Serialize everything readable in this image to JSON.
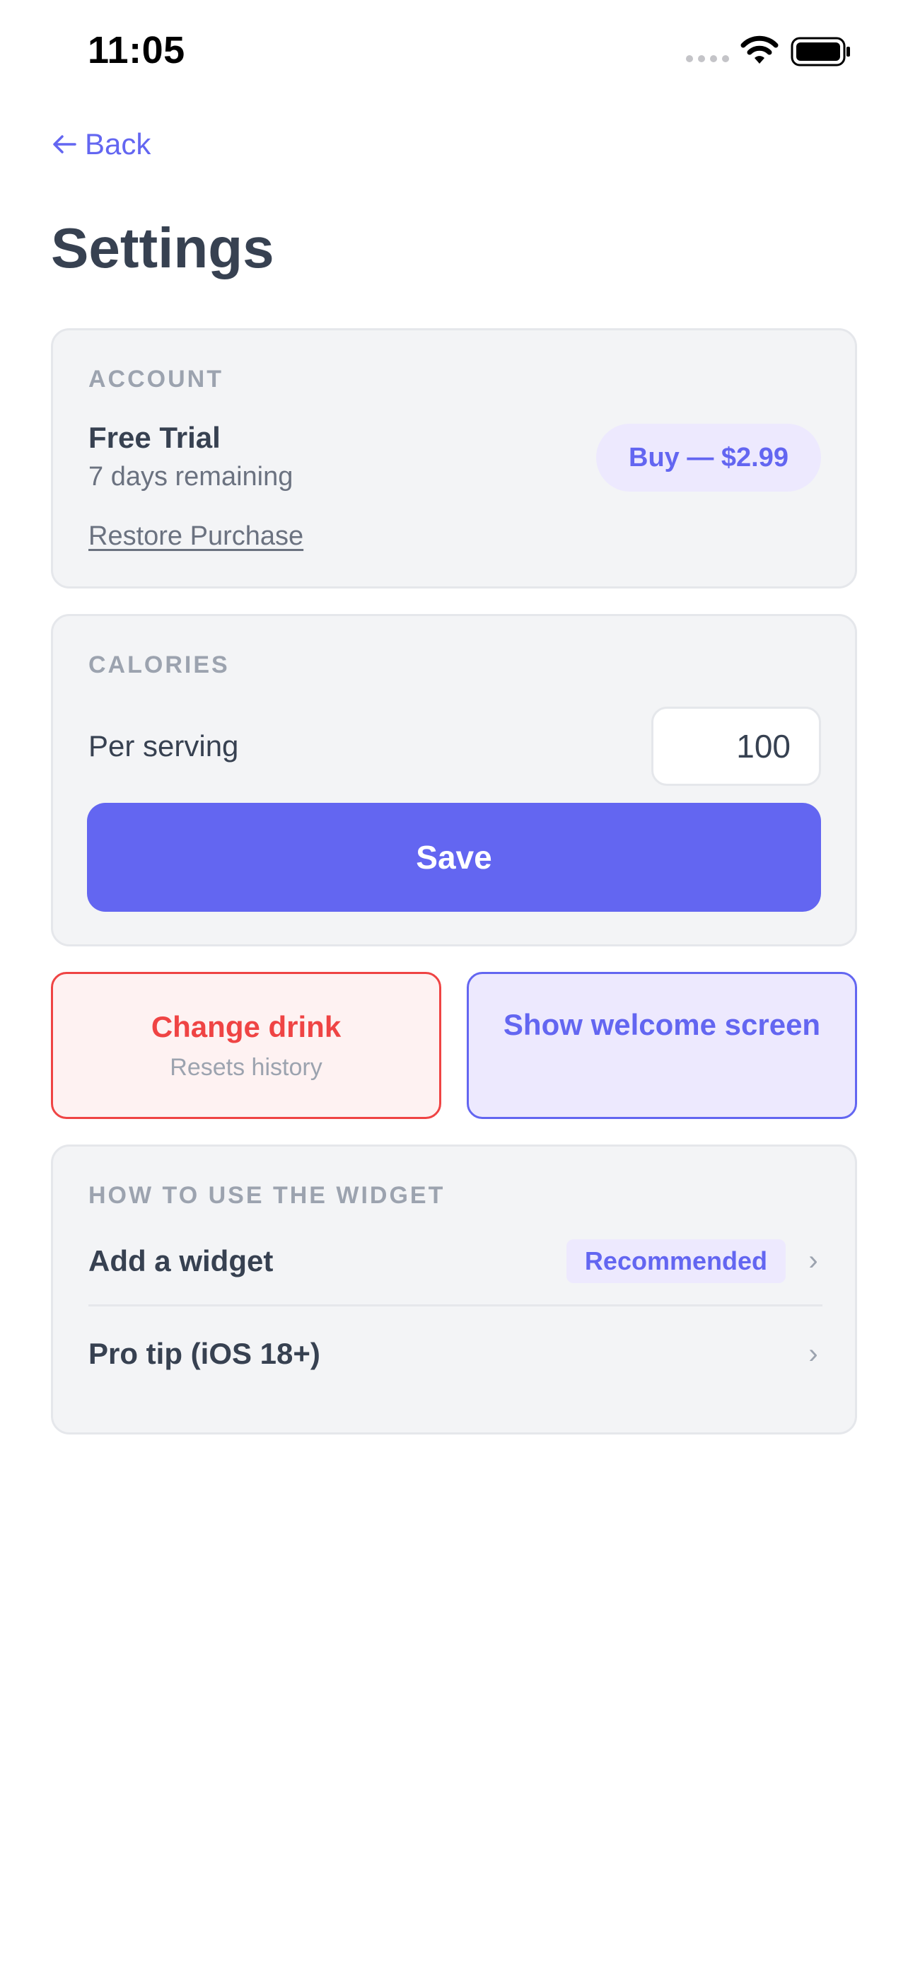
{
  "status_bar": {
    "time": "11:05",
    "icons": [
      "signal-icon",
      "wifi-icon",
      "battery-icon"
    ]
  },
  "nav": {
    "back_label": "Back",
    "back_icon": "arrow-left-icon"
  },
  "page": {
    "title": "Settings"
  },
  "account": {
    "section_label": "ACCOUNT",
    "plan_name": "Free Trial",
    "plan_remaining": "7 days remaining",
    "restore_label": "Restore Purchase",
    "buy_label": "Buy — $2.99"
  },
  "calories": {
    "section_label": "CALORIES",
    "per_serving_label": "Per serving",
    "per_serving_value": "100",
    "save_label": "Save"
  },
  "actions": {
    "change_drink": {
      "title": "Change drink",
      "subtitle": "Resets history"
    },
    "welcome": {
      "title": "Show welcome screen"
    }
  },
  "widget": {
    "section_label": "HOW TO USE THE WIDGET",
    "items": [
      {
        "label": "Add a widget",
        "badge": "Recommended"
      },
      {
        "label": "Pro tip (iOS 18+)"
      }
    ]
  },
  "colors": {
    "accent": "#6366f1",
    "accent_soft": "#ede9fe",
    "danger": "#ef4444",
    "danger_soft": "#fef2f2",
    "card_bg": "#f3f4f6",
    "text_primary": "#374151",
    "text_muted": "#9ca3af"
  }
}
